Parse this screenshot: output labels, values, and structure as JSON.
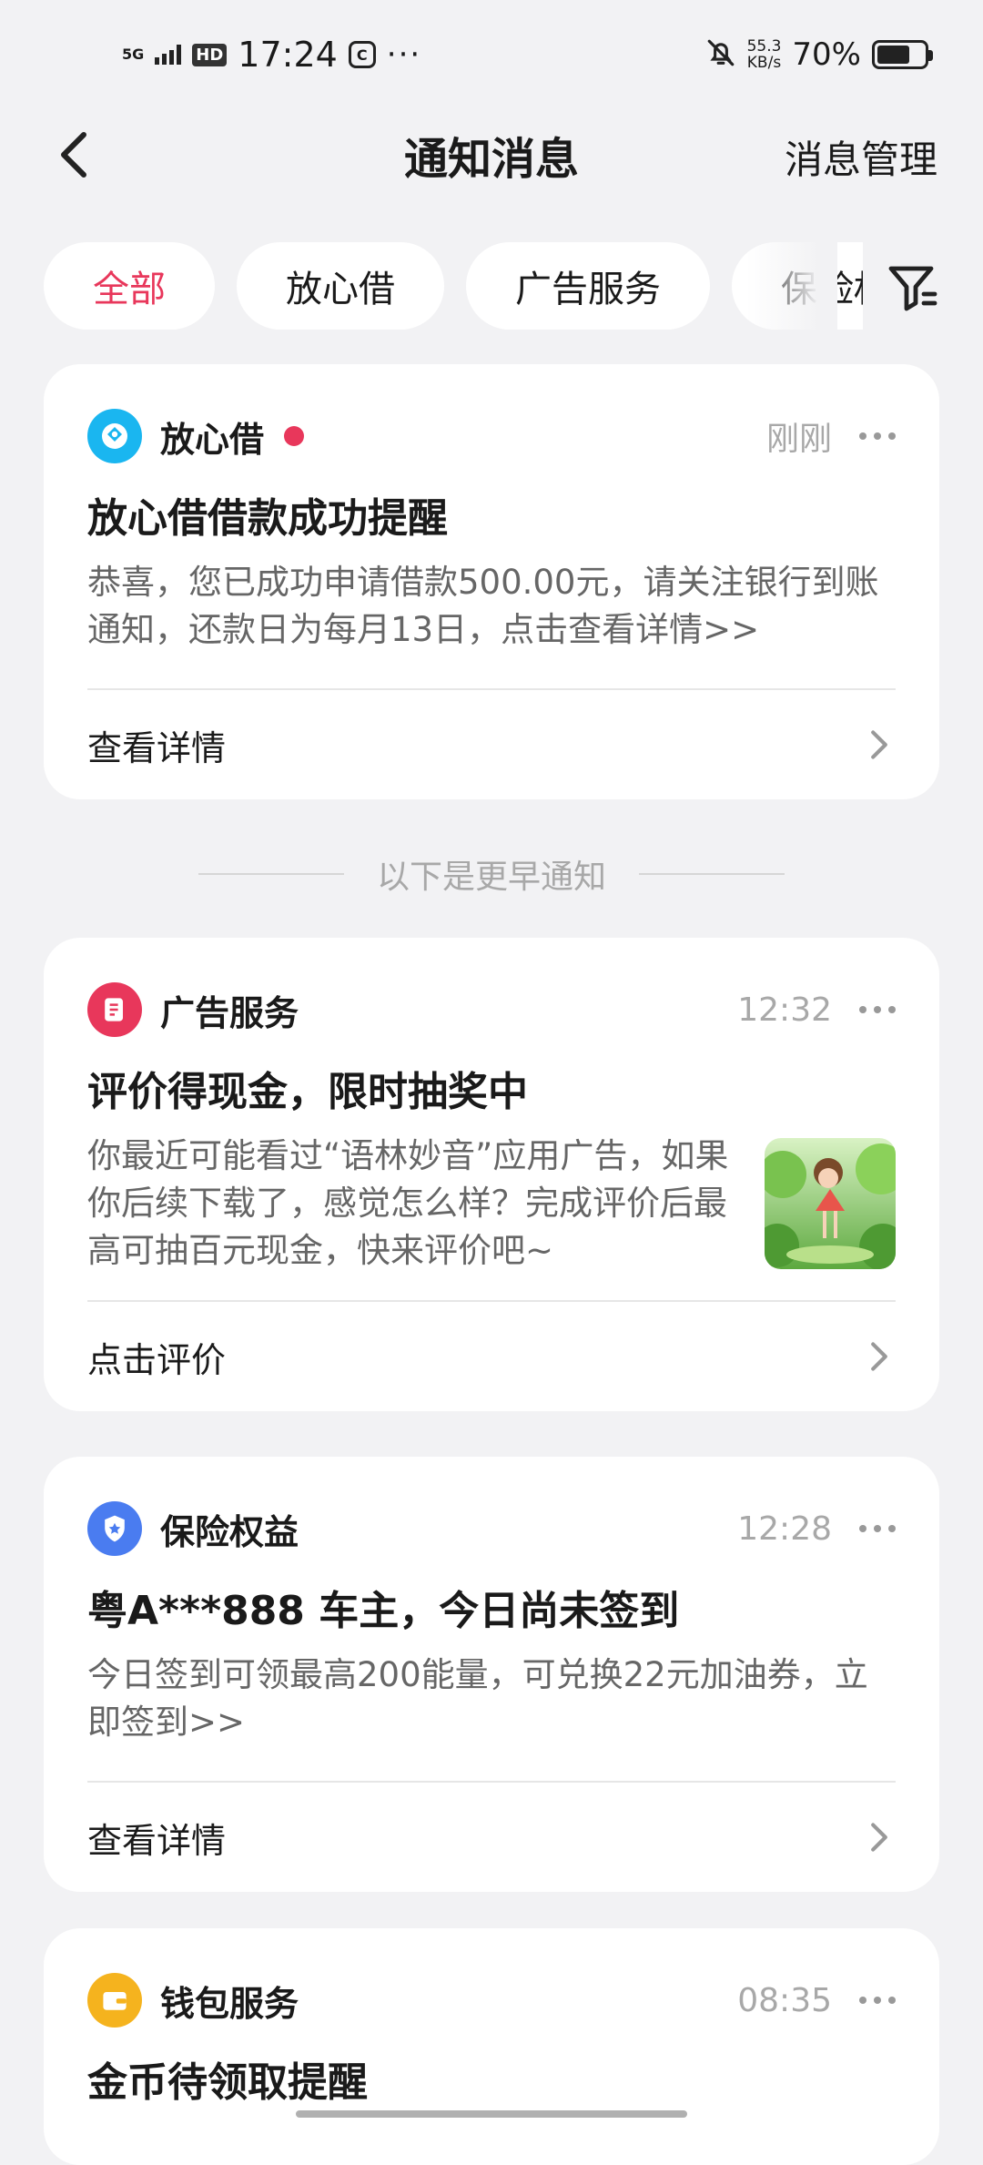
{
  "status_bar": {
    "network": "5G",
    "hd": "HD",
    "time": "17:24",
    "app_icon_letter": "C",
    "more": "···",
    "speed_value": "55.3",
    "speed_unit": "KB/s",
    "battery_pct": "70%",
    "battery_level": 0.7
  },
  "nav": {
    "title": "通知消息",
    "manage": "消息管理"
  },
  "filters": {
    "chips": [
      "全部",
      "放心借",
      "广告服务",
      "保险权益"
    ],
    "active_index": 0
  },
  "cards": [
    {
      "app_name": "放心借",
      "time": "刚刚",
      "unread": true,
      "title": "放心借借款成功提醒",
      "body": "恭喜，您已成功申请借款500.00元，请关注银行到账通知，还款日为每月13日，点击查看详情>>",
      "action": "查看详情",
      "icon_color": "#1ab6f0"
    },
    {
      "app_name": "广告服务",
      "time": "12:32",
      "title": "评价得现金，限时抽奖中",
      "body": "你最近可能看过“语林妙音”应用广告，如果你后续下载了，感觉怎么样？完成评价后最高可抽百元现金，快来评价吧~",
      "action": "点击评价",
      "icon_color": "#e8375b"
    },
    {
      "app_name": "保险权益",
      "time": "12:28",
      "title": "粤A***888 车主，今日尚未签到",
      "body": "今日签到可领最高200能量，可兑换22元加油券，立即签到>>",
      "action": "查看详情",
      "icon_color": "#4a7cf0"
    },
    {
      "app_name": "钱包服务",
      "time": "08:35",
      "title": "金币待领取提醒",
      "icon_color": "#f5b31e"
    }
  ],
  "earlier_label": "以下是更早通知",
  "colors": {
    "accent": "#e8375b",
    "background": "#f2f2f4",
    "muted": "#a8a8a8"
  }
}
